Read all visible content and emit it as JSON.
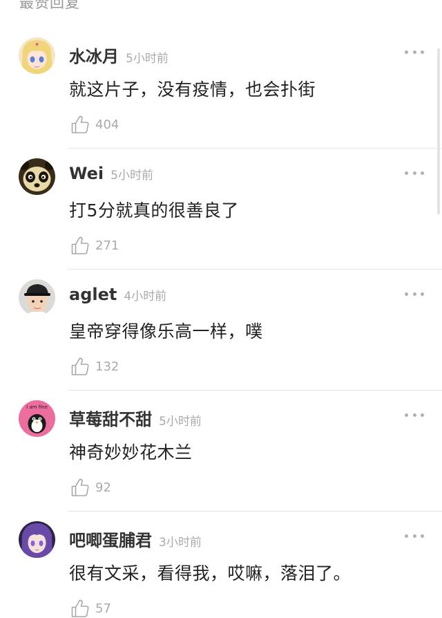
{
  "section_title": "最赞回复",
  "comments": [
    {
      "user": "水冰月",
      "time": "5小时前",
      "text": "就这片子，没有疫情，也会扑街",
      "likes": "404",
      "avatar": "sailor-moon-avatar"
    },
    {
      "user": "Wei",
      "time": "5小时前",
      "text": "打5分就真的很善良了",
      "likes": "271",
      "avatar": "kungfu-panda-avatar"
    },
    {
      "user": "aglet",
      "time": "4小时前",
      "text": "皇帝穿得像乐高一样，噗",
      "likes": "132",
      "avatar": "child-with-hat-avatar"
    },
    {
      "user": "草莓甜不甜",
      "time": "5小时前",
      "text": "神奇妙妙花木兰",
      "likes": "92",
      "avatar": "i-am-fine-avatar",
      "avatar_text": "I am fine"
    },
    {
      "user": "吧唧蛋脯君",
      "time": "3小时前",
      "text": "很有文采，看得我，哎嘛，落泪了。",
      "likes": "57",
      "avatar": "purple-hair-anime-avatar"
    }
  ],
  "colors": {
    "username": "#333333",
    "time": "#aaaaaa",
    "text": "#222222",
    "divider": "#e6e6e6",
    "icon": "#b0b0b0"
  }
}
